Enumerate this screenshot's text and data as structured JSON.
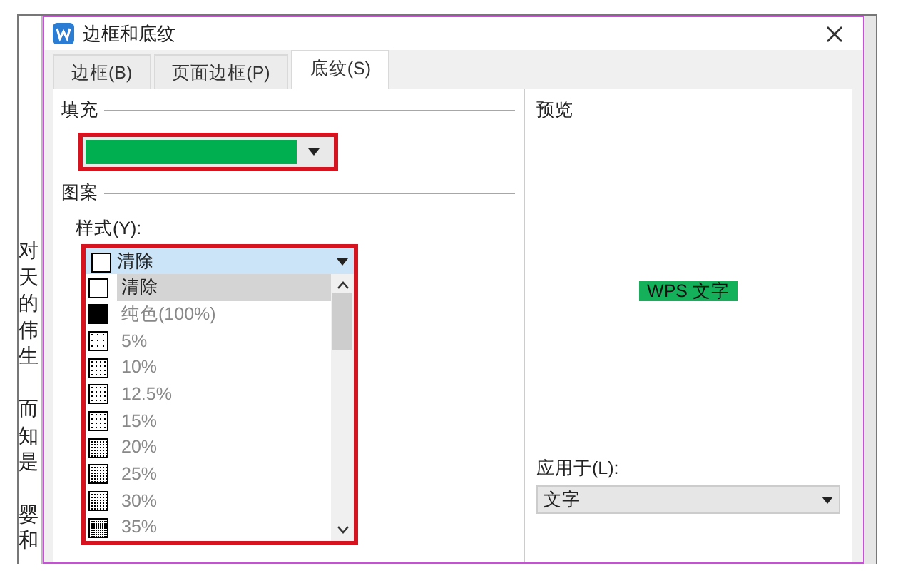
{
  "document": {
    "paragraphs": [
      {
        "lines": [
          "对",
          "天",
          "的",
          "伟",
          "生"
        ]
      },
      {
        "lines": [
          "而",
          "知",
          "是"
        ]
      },
      {
        "lines": [
          "婴",
          "和"
        ]
      }
    ]
  },
  "window": {
    "title": "边框和底纹"
  },
  "tabs": [
    {
      "label": "边框(B)",
      "selected": false
    },
    {
      "label": "页面边框(P)",
      "selected": false
    },
    {
      "label": "底纹(S)",
      "selected": true
    }
  ],
  "fill": {
    "label": "填充",
    "color": "#00b050"
  },
  "pattern": {
    "label": "图案",
    "style_label": "样式(Y):",
    "style_value": "清除",
    "options": [
      {
        "label": "清除",
        "kind": "clear",
        "selected": true
      },
      {
        "label": "纯色(100%)",
        "kind": "solid",
        "selected": false
      },
      {
        "label": "5%",
        "kind": "sparse",
        "selected": false
      },
      {
        "label": "10%",
        "kind": "dotted",
        "selected": false
      },
      {
        "label": "12.5%",
        "kind": "dotted",
        "selected": false
      },
      {
        "label": "15%",
        "kind": "dotted",
        "selected": false
      },
      {
        "label": "20%",
        "kind": "dense",
        "selected": false
      },
      {
        "label": "25%",
        "kind": "striped",
        "selected": false
      },
      {
        "label": "30%",
        "kind": "striped",
        "selected": false
      },
      {
        "label": "35%",
        "kind": "denser",
        "selected": false
      }
    ]
  },
  "preview": {
    "label": "预览",
    "sample": "WPS 文字"
  },
  "apply_to": {
    "label": "应用于(L):",
    "value": "文字"
  }
}
